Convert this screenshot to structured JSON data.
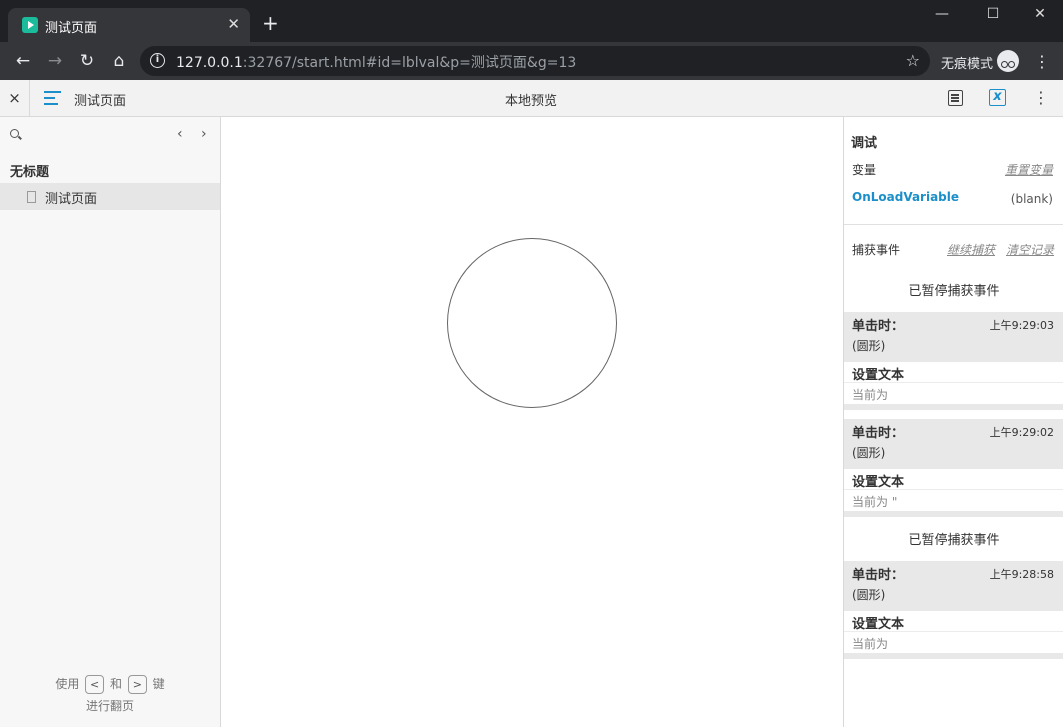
{
  "browser": {
    "tab_title": "测试页面",
    "url_host": "127.0.0.1",
    "url_rest": ":32767/start.html#id=lblval&p=测试页面&g=13",
    "incognito_label": "无痕模式"
  },
  "header": {
    "close_glyph": "×",
    "page_name": "测试页面",
    "center_title": "本地预览"
  },
  "sidebar": {
    "folder_title": "无标题",
    "pages": [
      {
        "label": "测试页面"
      }
    ],
    "hint": {
      "use": "使用",
      "key_prev": "<",
      "and": "和",
      "key_next": ">",
      "key_word": "键",
      "line2": "进行翻页"
    }
  },
  "panel": {
    "title": "调试",
    "variables_label": "变量",
    "reset_variables": "重置变量",
    "variables": [
      {
        "name": "OnLoadVariable",
        "value": "(blank)"
      }
    ],
    "trace_label": "捕获事件",
    "resume_trace": "继续捕获",
    "clear_trace": "清空记录",
    "paused_text": "已暂停捕获事件",
    "events": [
      {
        "name": "单击时：",
        "time": "上午9:29:03",
        "target": "(圆形)",
        "action": "设置文本",
        "detail": "当前为"
      },
      {
        "name": "单击时：",
        "time": "上午9:29:02",
        "target": "(圆形)",
        "action": "设置文本",
        "detail": "当前为 \""
      },
      {
        "name": "单击时：",
        "time": "上午9:28:58",
        "target": "(圆形)",
        "action": "设置文本",
        "detail": "当前为"
      }
    ]
  },
  "colors": {
    "accent": "#1a8fc9",
    "titlebar": "#202124",
    "toolbar": "#35363a",
    "favicon": "#1abc9c"
  },
  "icons": [
    "play-favicon-icon",
    "close-icon",
    "plus-icon",
    "minimize-icon",
    "maximize-icon",
    "back-arrow-icon",
    "forward-arrow-icon",
    "reload-icon",
    "home-icon",
    "info-icon",
    "star-icon",
    "incognito-icon",
    "kebab-menu-icon",
    "hamburger-menu-icon",
    "notes-icon",
    "console-icon",
    "search-icon",
    "chevron-left-icon",
    "chevron-right-icon",
    "page-icon"
  ]
}
